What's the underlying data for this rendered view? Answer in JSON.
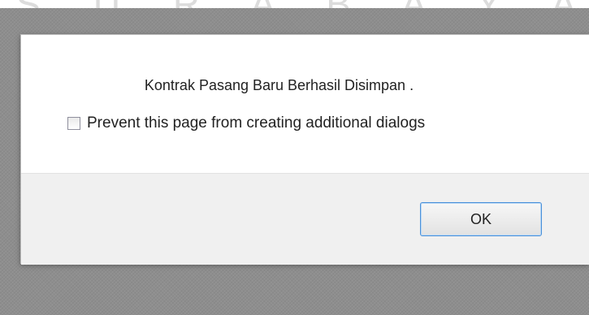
{
  "background": {
    "watermark_text": "S U R A B A Y A"
  },
  "dialog": {
    "message": "Kontrak Pasang Baru Berhasil Disimpan .",
    "checkbox": {
      "label": "Prevent this page from creating additional dialogs",
      "checked": false
    },
    "ok_label": "OK"
  },
  "colors": {
    "overlay": "#8e8e8e",
    "dialog_body": "#ffffff",
    "dialog_footer": "#f0f0f0",
    "button_focus_border": "#4a90d9"
  }
}
